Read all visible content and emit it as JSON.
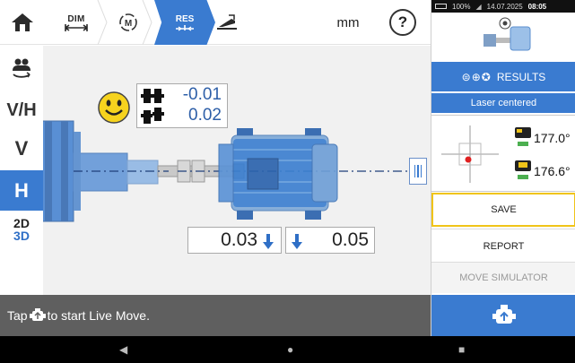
{
  "toolbar": {
    "dim_label": "DIM",
    "res_label": "RES",
    "unit": "mm",
    "help_symbol": "?",
    "icons": [
      "home-icon",
      "dimensions-icon",
      "measure-icon",
      "results-icon",
      "move-icon",
      "help-icon"
    ]
  },
  "sidebar": {
    "view_icon": "machine-view-icon",
    "vh_label": "V/H",
    "v_label": "V",
    "h_label": "H",
    "d2_label": "2D",
    "d3_label": "3D"
  },
  "coupling": {
    "gap_value": "-0.01",
    "offset_value": "0.02",
    "status_icon": "smiley-good-icon"
  },
  "feet": {
    "front_value": "0.03",
    "back_value": "0.05"
  },
  "status_bar": {
    "prefix": "Tap",
    "suffix": "to start Live Move."
  },
  "right_panel": {
    "system": {
      "battery": "100%",
      "date": "14.07.2025",
      "time": "08:05"
    },
    "results_label": "RESULTS",
    "laser_label": "Laser centered",
    "sensor": {
      "reading_1": "177.0°",
      "reading_2": "176.6°"
    },
    "save_label": "SAVE",
    "report_label": "REPORT",
    "move_simulator_label": "MOVE SIMULATOR"
  },
  "nav": {
    "back": "◀",
    "home": "●",
    "recent": "■"
  },
  "colors": {
    "accent": "#3a7bd0",
    "highlight": "#f0c419",
    "status_bg": "#5f5f5f",
    "value_blue": "#2e5fa8"
  }
}
